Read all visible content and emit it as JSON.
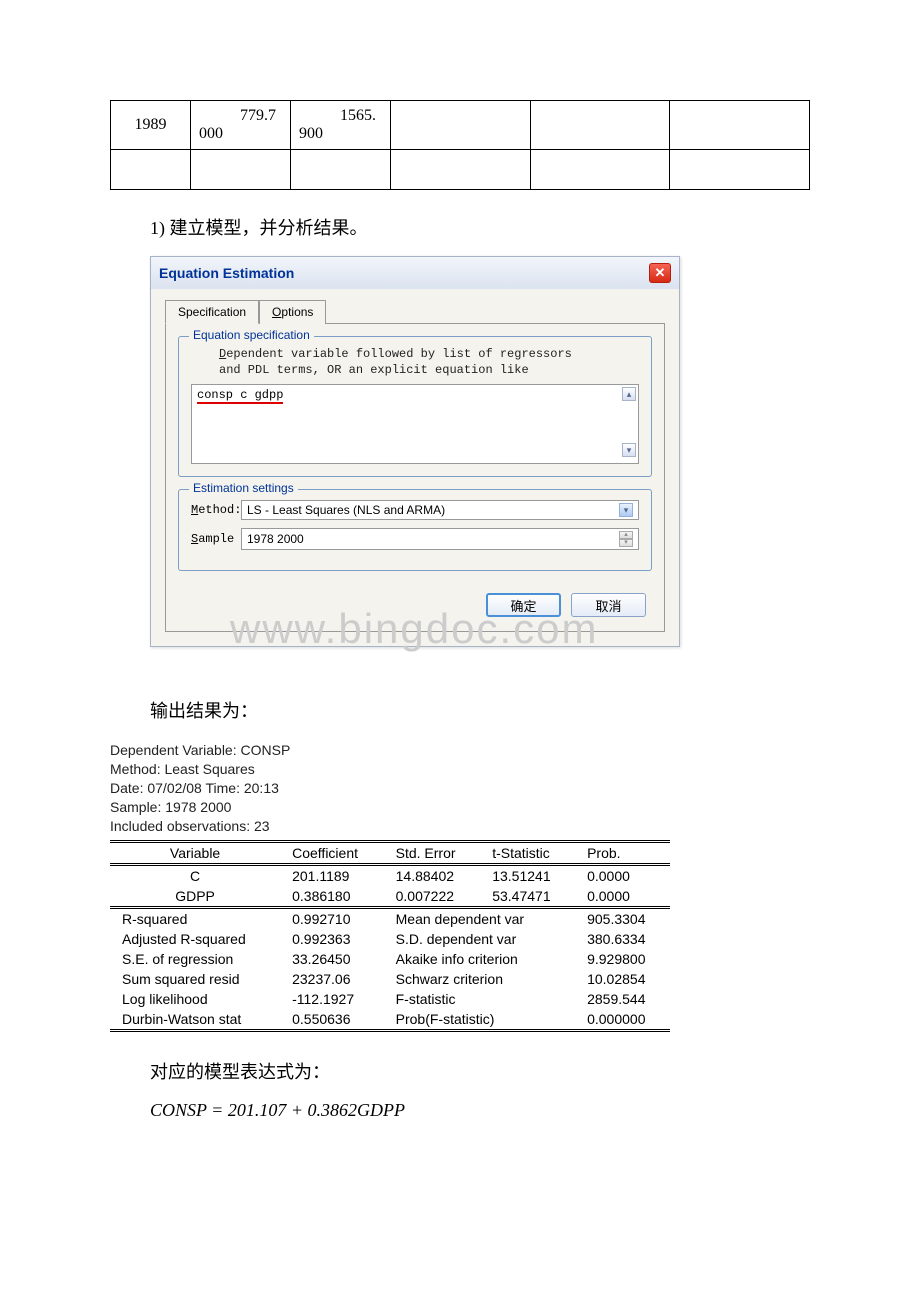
{
  "top_table": {
    "row1": {
      "year": "1989",
      "val1_a": "779.7",
      "val1_b": "000",
      "val2_a": "1565.",
      "val2_b": "900"
    }
  },
  "text": {
    "step1": "1) 建立模型，并分析结果。",
    "output_label": "输出结果为：",
    "model_label": "对应的模型表达式为："
  },
  "dialog": {
    "title": "Equation Estimation",
    "tab_spec": "Specification",
    "tab_opt_u": "O",
    "tab_opt_rest": "ptions",
    "grp_spec_title": "Equation specification",
    "grp_spec_desc_u": "D",
    "grp_spec_desc_rest": "ependent variable followed by list of regressors\nand PDL terms, OR an explicit equation like",
    "equation_text": "consp c gdpp",
    "grp_est_title": "Estimation settings",
    "method_u": "M",
    "method_rest": "ethod:",
    "method_value": "LS - Least Squares (NLS and ARMA)",
    "sample_u": "S",
    "sample_rest": "ample",
    "sample_value": "1978 2000",
    "ok": "确定",
    "cancel": "取消"
  },
  "watermark": "www.bingdoc.com",
  "results_meta": {
    "l1": "Dependent Variable: CONSP",
    "l2": "Method: Least Squares",
    "l3": "Date: 07/02/08   Time: 20:13",
    "l4": "Sample: 1978 2000",
    "l5": "Included observations: 23"
  },
  "results_cols": {
    "c1": "Variable",
    "c2": "Coefficient",
    "c3": "Std. Error",
    "c4": "t-Statistic",
    "c5": "Prob."
  },
  "coef_rows": [
    {
      "v": "C",
      "coef": "201.1189",
      "se": "14.88402",
      "t": "13.51241",
      "p": "0.0000"
    },
    {
      "v": "GDPP",
      "coef": "0.386180",
      "se": "0.007222",
      "t": "53.47471",
      "p": "0.0000"
    }
  ],
  "stats": [
    {
      "l": "R-squared",
      "lv": "0.992710",
      "r": "Mean dependent var",
      "rv": "905.3304"
    },
    {
      "l": "Adjusted R-squared",
      "lv": "0.992363",
      "r": "S.D. dependent var",
      "rv": "380.6334"
    },
    {
      "l": "S.E. of regression",
      "lv": "33.26450",
      "r": "Akaike info criterion",
      "rv": "9.929800"
    },
    {
      "l": "Sum squared resid",
      "lv": "23237.06",
      "r": "Schwarz criterion",
      "rv": "10.02854"
    },
    {
      "l": "Log likelihood",
      "lv": "-112.1927",
      "r": "F-statistic",
      "rv": "2859.544"
    },
    {
      "l": "Durbin-Watson stat",
      "lv": "0.550636",
      "r": "Prob(F-statistic)",
      "rv": "0.000000"
    }
  ],
  "equation": "CONSP = 201.107 + 0.3862GDPP"
}
